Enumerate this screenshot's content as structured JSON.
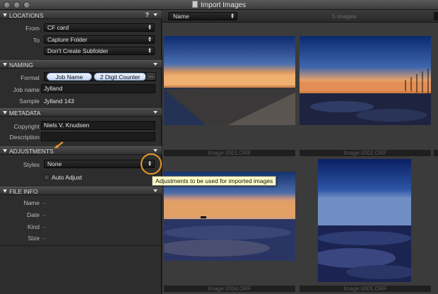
{
  "window": {
    "title": "Import Images"
  },
  "sections": {
    "locations": {
      "title": "LOCATIONS",
      "help": "?",
      "from_label": "From",
      "from_value": "CF card",
      "to_label": "To",
      "to_value": "Capture Folder",
      "subfolder_value": "Don't Create Subfolder"
    },
    "naming": {
      "title": "NAMING",
      "format_label": "Format",
      "tokens": [
        "Job Name",
        "2 Digit Counter"
      ],
      "more": "...",
      "jobname_label": "Job name",
      "jobname_value": "Jylland",
      "sample_label": "Sample",
      "sample_value": "Jylland 143"
    },
    "metadata": {
      "title": "METADATA",
      "copyright_label": "Copyright",
      "copyright_value": "Niels V. Knudsen",
      "description_label": "Description",
      "description_value": ""
    },
    "adjustments": {
      "title": "ADJUSTMENTS",
      "styles_label": "Styles",
      "styles_value": "None",
      "auto_adjust_label": "Auto Adjust",
      "tooltip": "Adjustments to be used for imported images"
    },
    "file_info": {
      "title": "FILE INFO",
      "fields": [
        {
          "label": "Name",
          "value": "--"
        },
        {
          "label": "Date",
          "value": "--"
        },
        {
          "label": "Kind",
          "value": "--"
        },
        {
          "label": "Size",
          "value": "--"
        }
      ]
    }
  },
  "browser": {
    "sort_value": "Name",
    "count": "5 images",
    "thumbnails": [
      {
        "caption": "Image 0001.ORF"
      },
      {
        "caption": "Image 0002.ORF"
      },
      {
        "caption": "Image 0004.ORF"
      },
      {
        "caption": "Image 0005.ORF"
      }
    ]
  },
  "colors": {
    "accent_orange": "#e59b2a",
    "tooltip_bg": "#fdfdc8",
    "token_bg": "#dbe6fa"
  }
}
